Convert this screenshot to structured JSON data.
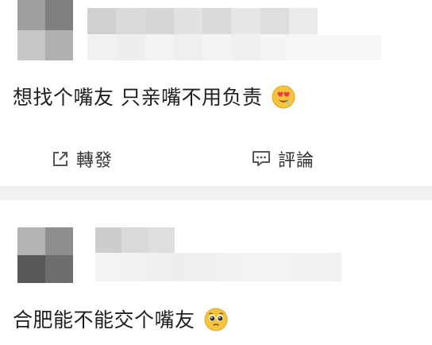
{
  "posts": [
    {
      "text": "想找个嘴友 只亲嘴不用负责",
      "emoji": "smiling-face-with-heart-eyes-icon"
    },
    {
      "text": "合肥能不能交个嘴友",
      "emoji": "pleading-face-icon"
    }
  ],
  "actions": {
    "repost": {
      "label": "轉發",
      "icon": "share-icon"
    },
    "comment": {
      "label": "評論",
      "icon": "comment-icon"
    }
  },
  "colors": {
    "text": "#1f1f1f",
    "icon": "#555555",
    "separator": "#f1f1f1"
  }
}
